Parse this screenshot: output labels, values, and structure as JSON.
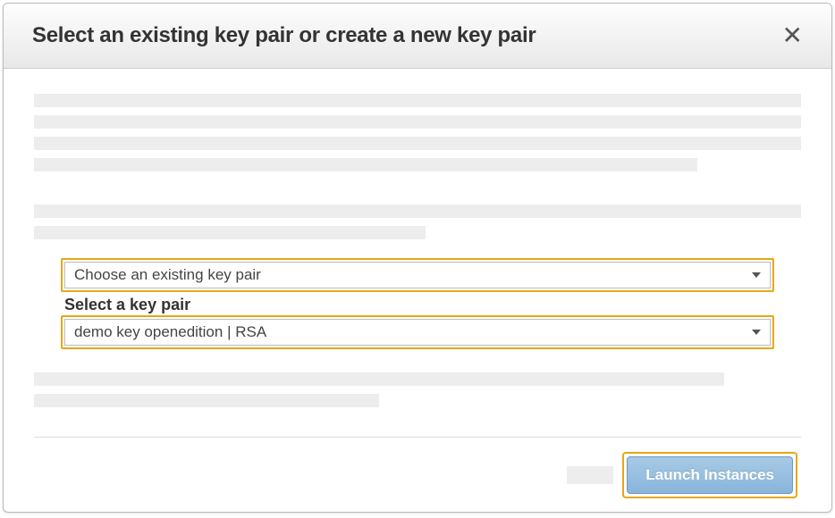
{
  "modal": {
    "title": "Select an existing key pair or create a new key pair"
  },
  "dropdowns": {
    "keypair_option": "Choose an existing key pair",
    "select_label": "Select a key pair",
    "selected_keypair": "demo key openedition | RSA"
  },
  "footer": {
    "launch_label": "Launch Instances"
  }
}
